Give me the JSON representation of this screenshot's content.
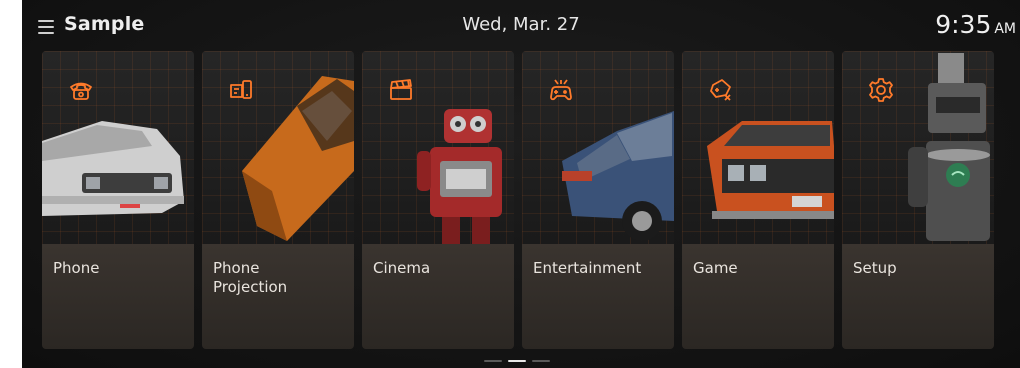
{
  "header": {
    "app_title": "Sample",
    "date": "Wed, Mar. 27",
    "time": "9:35",
    "ampm": "AM"
  },
  "tiles": [
    {
      "label": "Phone",
      "icon": "phone-icon"
    },
    {
      "label": "Phone\nProjection",
      "icon": "phone-projection-icon"
    },
    {
      "label": "Cinema",
      "icon": "clapperboard-icon"
    },
    {
      "label": "Entertainment",
      "icon": "entertainment-icon"
    },
    {
      "label": "Game",
      "icon": "game-icon"
    },
    {
      "label": "Setup",
      "icon": "gear-icon"
    }
  ],
  "pager": {
    "pages": 3,
    "active_page": 2
  },
  "colors": {
    "accent": "#ff7a2a",
    "panel": "#3a342f",
    "background": "#141414"
  }
}
